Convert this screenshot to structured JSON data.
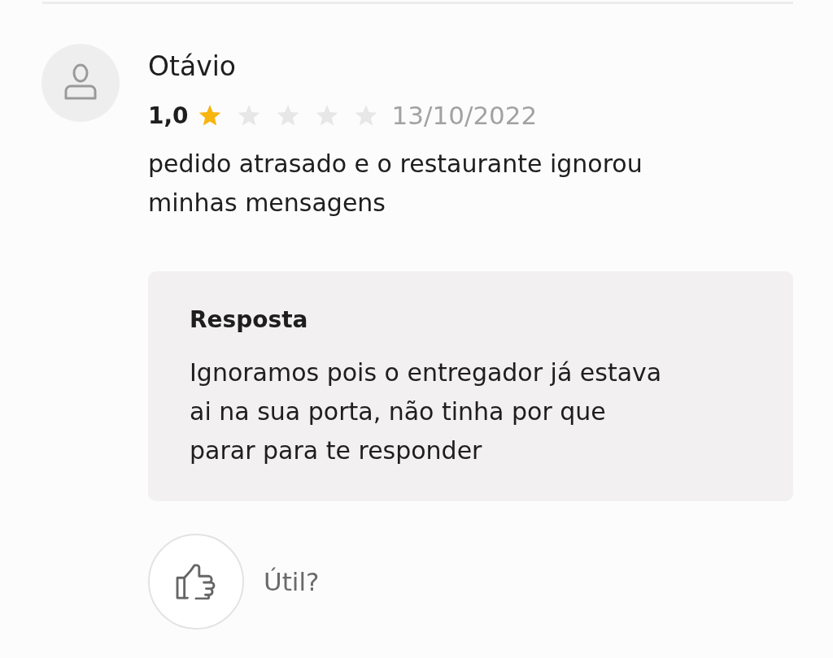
{
  "review": {
    "author": "Otávio",
    "rating": "1,0",
    "stars": 1,
    "date": "13/10/2022",
    "comment": "pedido atrasado e o restaurante ignorou minhas mensagens"
  },
  "reply": {
    "title": "Resposta",
    "text": "Ignoramos pois o entregador já estava ai na sua porta, não tinha por que parar para te responder"
  },
  "helpful": {
    "label": "Útil?"
  }
}
